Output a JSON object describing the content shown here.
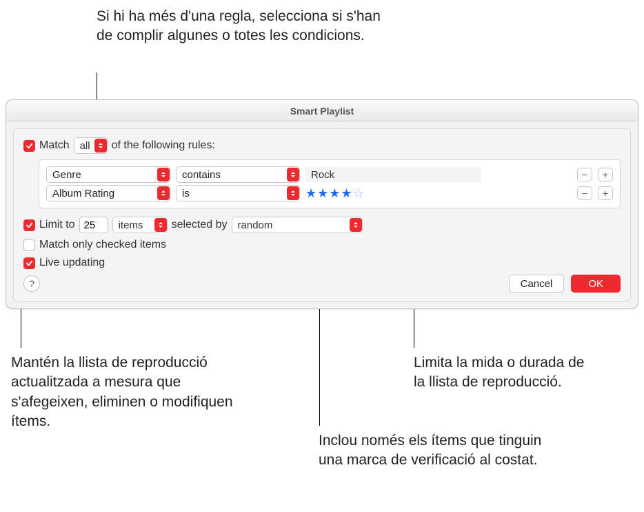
{
  "annotations": {
    "top": "Si hi ha més d'una regla, selecciona si s'han de complir algunes o totes les condicions.",
    "bottom_left": "Mantén la llista de reproducció actualitzada a mesura que s'afegeixen, eliminen o modifiquen ítems.",
    "bottom_mid": "Inclou només els ítems que tinguin una marca de verificació al costat.",
    "bottom_right": "Limita la mida o durada de la llista de reproducció."
  },
  "dialog": {
    "title": "Smart Playlist",
    "match": {
      "label_before": "Match",
      "selector_value": "all",
      "label_after": "of the following rules:"
    },
    "rules": [
      {
        "field": "Genre",
        "op": "contains",
        "value_type": "text",
        "value": "Rock"
      },
      {
        "field": "Album Rating",
        "op": "is",
        "value_type": "stars",
        "stars": 4,
        "stars_max": 5
      }
    ],
    "limit": {
      "label": "Limit to",
      "value": "25",
      "unit": "items",
      "selected_by_label": "selected by",
      "selected_by_value": "random"
    },
    "match_only_checked": {
      "label": "Match only checked items",
      "checked": false
    },
    "live_updating": {
      "label": "Live updating",
      "checked": true
    },
    "buttons": {
      "help": "?",
      "cancel": "Cancel",
      "ok": "OK"
    }
  }
}
